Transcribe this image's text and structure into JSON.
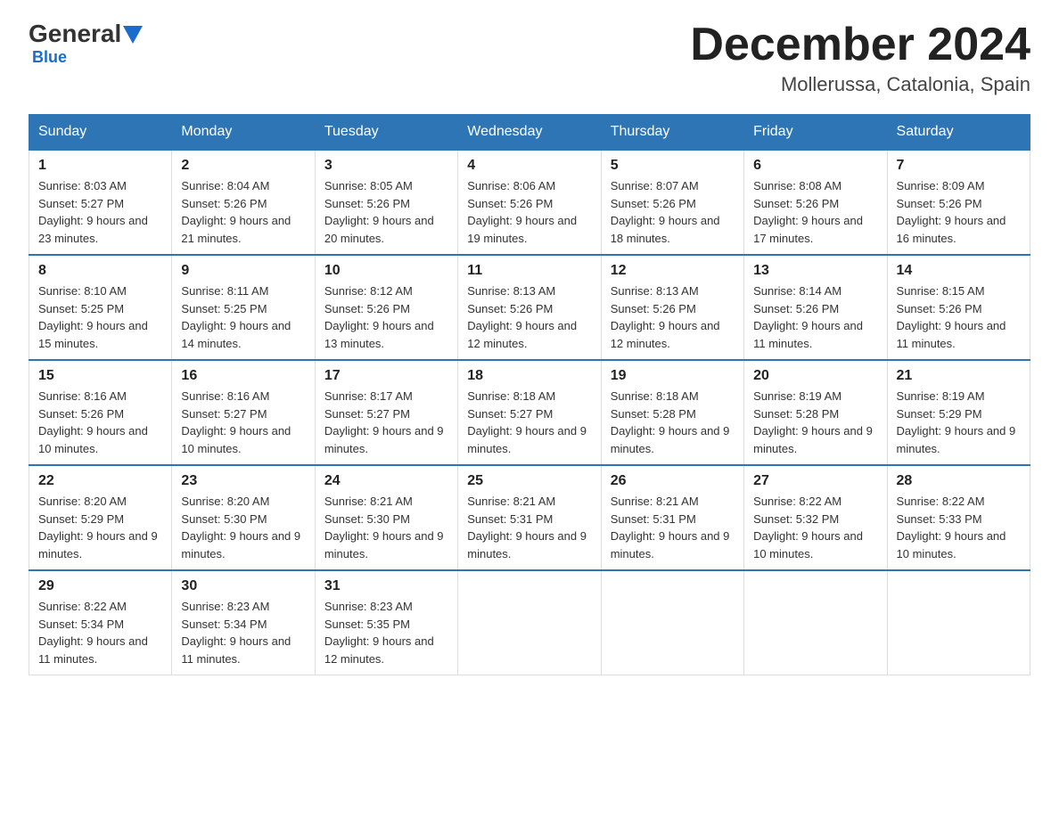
{
  "logo": {
    "text_general": "General",
    "text_blue": "Blue"
  },
  "header": {
    "month": "December 2024",
    "location": "Mollerussa, Catalonia, Spain"
  },
  "days_of_week": [
    "Sunday",
    "Monday",
    "Tuesday",
    "Wednesday",
    "Thursday",
    "Friday",
    "Saturday"
  ],
  "weeks": [
    [
      {
        "day": "1",
        "sunrise": "Sunrise: 8:03 AM",
        "sunset": "Sunset: 5:27 PM",
        "daylight": "Daylight: 9 hours and 23 minutes."
      },
      {
        "day": "2",
        "sunrise": "Sunrise: 8:04 AM",
        "sunset": "Sunset: 5:26 PM",
        "daylight": "Daylight: 9 hours and 21 minutes."
      },
      {
        "day": "3",
        "sunrise": "Sunrise: 8:05 AM",
        "sunset": "Sunset: 5:26 PM",
        "daylight": "Daylight: 9 hours and 20 minutes."
      },
      {
        "day": "4",
        "sunrise": "Sunrise: 8:06 AM",
        "sunset": "Sunset: 5:26 PM",
        "daylight": "Daylight: 9 hours and 19 minutes."
      },
      {
        "day": "5",
        "sunrise": "Sunrise: 8:07 AM",
        "sunset": "Sunset: 5:26 PM",
        "daylight": "Daylight: 9 hours and 18 minutes."
      },
      {
        "day": "6",
        "sunrise": "Sunrise: 8:08 AM",
        "sunset": "Sunset: 5:26 PM",
        "daylight": "Daylight: 9 hours and 17 minutes."
      },
      {
        "day": "7",
        "sunrise": "Sunrise: 8:09 AM",
        "sunset": "Sunset: 5:26 PM",
        "daylight": "Daylight: 9 hours and 16 minutes."
      }
    ],
    [
      {
        "day": "8",
        "sunrise": "Sunrise: 8:10 AM",
        "sunset": "Sunset: 5:25 PM",
        "daylight": "Daylight: 9 hours and 15 minutes."
      },
      {
        "day": "9",
        "sunrise": "Sunrise: 8:11 AM",
        "sunset": "Sunset: 5:25 PM",
        "daylight": "Daylight: 9 hours and 14 minutes."
      },
      {
        "day": "10",
        "sunrise": "Sunrise: 8:12 AM",
        "sunset": "Sunset: 5:26 PM",
        "daylight": "Daylight: 9 hours and 13 minutes."
      },
      {
        "day": "11",
        "sunrise": "Sunrise: 8:13 AM",
        "sunset": "Sunset: 5:26 PM",
        "daylight": "Daylight: 9 hours and 12 minutes."
      },
      {
        "day": "12",
        "sunrise": "Sunrise: 8:13 AM",
        "sunset": "Sunset: 5:26 PM",
        "daylight": "Daylight: 9 hours and 12 minutes."
      },
      {
        "day": "13",
        "sunrise": "Sunrise: 8:14 AM",
        "sunset": "Sunset: 5:26 PM",
        "daylight": "Daylight: 9 hours and 11 minutes."
      },
      {
        "day": "14",
        "sunrise": "Sunrise: 8:15 AM",
        "sunset": "Sunset: 5:26 PM",
        "daylight": "Daylight: 9 hours and 11 minutes."
      }
    ],
    [
      {
        "day": "15",
        "sunrise": "Sunrise: 8:16 AM",
        "sunset": "Sunset: 5:26 PM",
        "daylight": "Daylight: 9 hours and 10 minutes."
      },
      {
        "day": "16",
        "sunrise": "Sunrise: 8:16 AM",
        "sunset": "Sunset: 5:27 PM",
        "daylight": "Daylight: 9 hours and 10 minutes."
      },
      {
        "day": "17",
        "sunrise": "Sunrise: 8:17 AM",
        "sunset": "Sunset: 5:27 PM",
        "daylight": "Daylight: 9 hours and 9 minutes."
      },
      {
        "day": "18",
        "sunrise": "Sunrise: 8:18 AM",
        "sunset": "Sunset: 5:27 PM",
        "daylight": "Daylight: 9 hours and 9 minutes."
      },
      {
        "day": "19",
        "sunrise": "Sunrise: 8:18 AM",
        "sunset": "Sunset: 5:28 PM",
        "daylight": "Daylight: 9 hours and 9 minutes."
      },
      {
        "day": "20",
        "sunrise": "Sunrise: 8:19 AM",
        "sunset": "Sunset: 5:28 PM",
        "daylight": "Daylight: 9 hours and 9 minutes."
      },
      {
        "day": "21",
        "sunrise": "Sunrise: 8:19 AM",
        "sunset": "Sunset: 5:29 PM",
        "daylight": "Daylight: 9 hours and 9 minutes."
      }
    ],
    [
      {
        "day": "22",
        "sunrise": "Sunrise: 8:20 AM",
        "sunset": "Sunset: 5:29 PM",
        "daylight": "Daylight: 9 hours and 9 minutes."
      },
      {
        "day": "23",
        "sunrise": "Sunrise: 8:20 AM",
        "sunset": "Sunset: 5:30 PM",
        "daylight": "Daylight: 9 hours and 9 minutes."
      },
      {
        "day": "24",
        "sunrise": "Sunrise: 8:21 AM",
        "sunset": "Sunset: 5:30 PM",
        "daylight": "Daylight: 9 hours and 9 minutes."
      },
      {
        "day": "25",
        "sunrise": "Sunrise: 8:21 AM",
        "sunset": "Sunset: 5:31 PM",
        "daylight": "Daylight: 9 hours and 9 minutes."
      },
      {
        "day": "26",
        "sunrise": "Sunrise: 8:21 AM",
        "sunset": "Sunset: 5:31 PM",
        "daylight": "Daylight: 9 hours and 9 minutes."
      },
      {
        "day": "27",
        "sunrise": "Sunrise: 8:22 AM",
        "sunset": "Sunset: 5:32 PM",
        "daylight": "Daylight: 9 hours and 10 minutes."
      },
      {
        "day": "28",
        "sunrise": "Sunrise: 8:22 AM",
        "sunset": "Sunset: 5:33 PM",
        "daylight": "Daylight: 9 hours and 10 minutes."
      }
    ],
    [
      {
        "day": "29",
        "sunrise": "Sunrise: 8:22 AM",
        "sunset": "Sunset: 5:34 PM",
        "daylight": "Daylight: 9 hours and 11 minutes."
      },
      {
        "day": "30",
        "sunrise": "Sunrise: 8:23 AM",
        "sunset": "Sunset: 5:34 PM",
        "daylight": "Daylight: 9 hours and 11 minutes."
      },
      {
        "day": "31",
        "sunrise": "Sunrise: 8:23 AM",
        "sunset": "Sunset: 5:35 PM",
        "daylight": "Daylight: 9 hours and 12 minutes."
      },
      null,
      null,
      null,
      null
    ]
  ]
}
